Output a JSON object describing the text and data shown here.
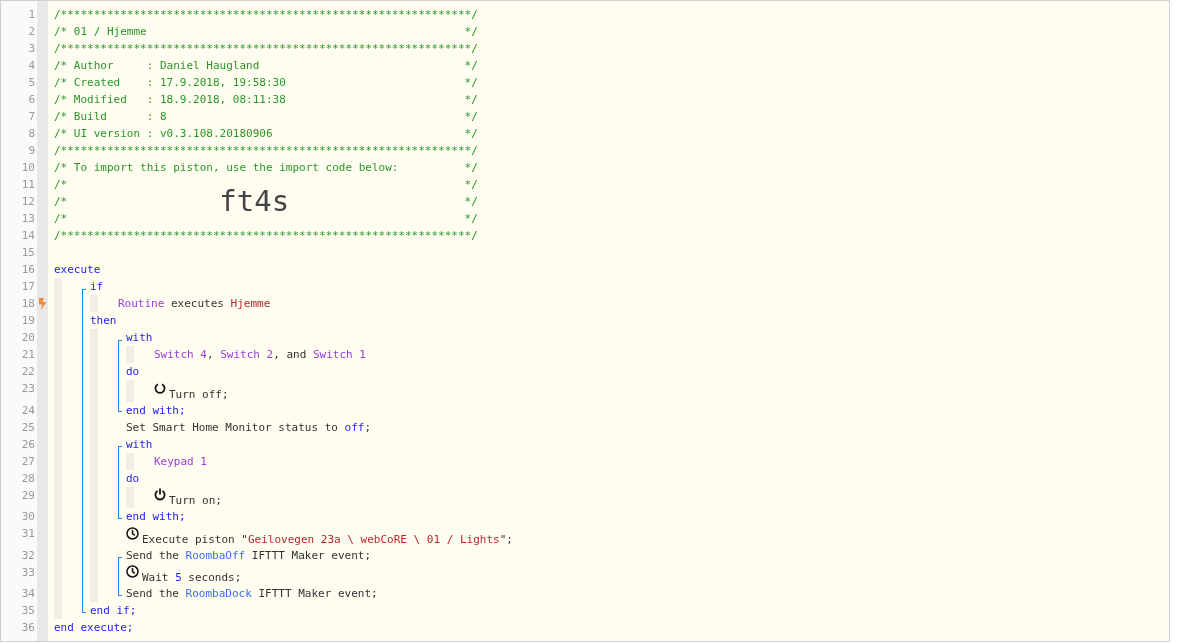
{
  "lines": [
    {
      "line": "1",
      "kind": "comment",
      "trigger": false,
      "tokens": [
        {
          "kind": "comment",
          "text": "/**************************************************************/"
        }
      ]
    },
    {
      "line": "2",
      "kind": "comment",
      "trigger": false,
      "tokens": [
        {
          "kind": "comment",
          "text": "/* 01 / Hjemme"
        },
        {
          "kind": "comment",
          "text": "*/"
        }
      ]
    },
    {
      "line": "3",
      "kind": "comment",
      "trigger": false,
      "tokens": [
        {
          "kind": "comment",
          "text": "/**************************************************************/"
        }
      ]
    },
    {
      "line": "4",
      "kind": "comment",
      "trigger": false,
      "tokens": [
        {
          "kind": "comment",
          "text": "/* Author     : Daniel Haugland"
        },
        {
          "kind": "comment",
          "text": "*/"
        }
      ]
    },
    {
      "line": "5",
      "kind": "comment",
      "trigger": false,
      "tokens": [
        {
          "kind": "comment",
          "text": "/* Created    : 17.9.2018, 19:58:30"
        },
        {
          "kind": "comment",
          "text": "*/"
        }
      ]
    },
    {
      "line": "6",
      "kind": "comment",
      "trigger": false,
      "tokens": [
        {
          "kind": "comment",
          "text": "/* Modified   : 18.9.2018, 08:11:38"
        },
        {
          "kind": "comment",
          "text": "*/"
        }
      ]
    },
    {
      "line": "7",
      "kind": "comment",
      "trigger": false,
      "tokens": [
        {
          "kind": "comment",
          "text": "/* Build      : 8"
        },
        {
          "kind": "comment",
          "text": "*/"
        }
      ]
    },
    {
      "line": "8",
      "kind": "comment",
      "trigger": false,
      "tokens": [
        {
          "kind": "comment",
          "text": "/* UI version : v0.3.108.20180906"
        },
        {
          "kind": "comment",
          "text": "*/"
        }
      ]
    },
    {
      "line": "9",
      "kind": "comment",
      "trigger": false,
      "tokens": [
        {
          "kind": "comment",
          "text": "/**************************************************************/"
        }
      ]
    },
    {
      "line": "10",
      "kind": "comment",
      "trigger": false,
      "tokens": [
        {
          "kind": "comment",
          "text": "/* To import this piston, use the import code below:"
        },
        {
          "kind": "comment",
          "text": "*/"
        }
      ]
    },
    {
      "line": "11",
      "kind": "comment",
      "trigger": false,
      "tokens": [
        {
          "kind": "comment",
          "text": "/*"
        },
        {
          "kind": "comment",
          "text": "*/"
        }
      ]
    },
    {
      "line": "12",
      "kind": "import",
      "trigger": false,
      "tokens": [
        {
          "kind": "comment",
          "text": "/*"
        },
        {
          "kind": "code",
          "text": "ft4s"
        },
        {
          "kind": "comment",
          "text": "*/"
        }
      ]
    },
    {
      "line": "13",
      "kind": "comment",
      "trigger": false,
      "tokens": [
        {
          "kind": "comment",
          "text": "/*"
        },
        {
          "kind": "comment",
          "text": "*/"
        }
      ]
    },
    {
      "line": "14",
      "kind": "comment",
      "trigger": false,
      "tokens": [
        {
          "kind": "comment",
          "text": "/**************************************************************/"
        }
      ]
    },
    {
      "line": "15",
      "kind": "blank",
      "trigger": false
    },
    {
      "line": "16",
      "kind": "statement",
      "trigger": false,
      "tokens": [
        {
          "kind": "keyword",
          "text": "execute"
        }
      ],
      "children": [
        {
          "kind": "group",
          "children": [
            {
              "line": "17",
              "kind": "statement",
              "trigger": false,
              "tokens": [
                {
                  "kind": "keyword",
                  "text": "if"
                }
              ],
              "children": [
                {
                  "line": "18",
                  "kind": "statement",
                  "trigger": true,
                  "tokens": [
                    {
                      "kind": "device",
                      "text": "Routine"
                    },
                    {
                      "kind": "text",
                      "text": " executes "
                    },
                    {
                      "kind": "value",
                      "text": "Hjemme"
                    }
                  ]
                }
              ]
            },
            {
              "line": "19",
              "kind": "statement",
              "trigger": false,
              "tokens": [
                {
                  "kind": "keyword",
                  "text": "then"
                }
              ],
              "children": [
                {
                  "kind": "group",
                  "children": [
                    {
                      "line": "20",
                      "kind": "statement",
                      "trigger": false,
                      "tokens": [
                        {
                          "kind": "keyword",
                          "text": "with"
                        }
                      ],
                      "children": [
                        {
                          "line": "21",
                          "kind": "statement",
                          "trigger": false,
                          "tokens": [
                            {
                              "kind": "device",
                              "text": "Switch 4"
                            },
                            {
                              "kind": "text",
                              "text": ", "
                            },
                            {
                              "kind": "device",
                              "text": "Switch 2"
                            },
                            {
                              "kind": "text",
                              "text": ", and "
                            },
                            {
                              "kind": "device",
                              "text": "Switch 1"
                            }
                          ]
                        }
                      ]
                    },
                    {
                      "line": "22",
                      "kind": "statement",
                      "trigger": false,
                      "tokens": [
                        {
                          "kind": "keyword",
                          "text": "do"
                        }
                      ],
                      "children": [
                        {
                          "line": "23",
                          "kind": "task-off",
                          "trigger": false,
                          "tokens": [
                            {
                              "kind": "text",
                              "text": "Turn off;"
                            }
                          ]
                        }
                      ]
                    },
                    {
                      "line": "24",
                      "kind": "statement",
                      "trigger": false,
                      "tokens": [
                        {
                          "kind": "keyword",
                          "text": "end with;"
                        }
                      ]
                    }
                  ]
                },
                {
                  "line": "25",
                  "kind": "statement",
                  "trigger": false,
                  "tokens": [
                    {
                      "kind": "text",
                      "text": "Set Smart Home Monitor status to "
                    },
                    {
                      "kind": "keyword",
                      "text": "off"
                    },
                    {
                      "kind": "text",
                      "text": ";"
                    }
                  ]
                },
                {
                  "kind": "group",
                  "children": [
                    {
                      "line": "26",
                      "kind": "statement",
                      "trigger": false,
                      "tokens": [
                        {
                          "kind": "keyword",
                          "text": "with"
                        }
                      ],
                      "children": [
                        {
                          "line": "27",
                          "kind": "statement",
                          "trigger": false,
                          "tokens": [
                            {
                              "kind": "device",
                              "text": "Keypad 1"
                            }
                          ]
                        }
                      ]
                    },
                    {
                      "line": "28",
                      "kind": "statement",
                      "trigger": false,
                      "tokens": [
                        {
                          "kind": "keyword",
                          "text": "do"
                        }
                      ],
                      "children": [
                        {
                          "line": "29",
                          "kind": "task-on",
                          "trigger": false,
                          "tokens": [
                            {
                              "kind": "text",
                              "text": "Turn on;"
                            }
                          ]
                        }
                      ]
                    },
                    {
                      "line": "30",
                      "kind": "statement",
                      "trigger": false,
                      "tokens": [
                        {
                          "kind": "keyword",
                          "text": "end with;"
                        }
                      ]
                    }
                  ]
                },
                {
                  "line": "31",
                  "kind": "task-timed",
                  "trigger": false,
                  "tokens": [
                    {
                      "kind": "text",
                      "text": "Execute piston \""
                    },
                    {
                      "kind": "value",
                      "text": "Geilovegen 23a \\ webCoRE \\ 01 / Lights"
                    },
                    {
                      "kind": "text",
                      "text": "\";"
                    }
                  ]
                },
                {
                  "kind": "group",
                  "children": [
                    {
                      "line": "32",
                      "kind": "statement",
                      "trigger": false,
                      "tokens": [
                        {
                          "kind": "text",
                          "text": "Send the "
                        },
                        {
                          "kind": "event",
                          "text": "RoombaOff"
                        },
                        {
                          "kind": "text",
                          "text": " IFTTT Maker event;"
                        }
                      ]
                    },
                    {
                      "line": "33",
                      "kind": "task-timed",
                      "trigger": false,
                      "tokens": [
                        {
                          "kind": "text",
                          "text": "Wait "
                        },
                        {
                          "kind": "number",
                          "text": "5"
                        },
                        {
                          "kind": "text",
                          "text": " seconds;"
                        }
                      ]
                    },
                    {
                      "line": "34",
                      "kind": "statement",
                      "trigger": false,
                      "tokens": [
                        {
                          "kind": "text",
                          "text": "Send the "
                        },
                        {
                          "kind": "event",
                          "text": "RoombaDock"
                        },
                        {
                          "kind": "text",
                          "text": " IFTTT Maker event;"
                        }
                      ]
                    }
                  ]
                }
              ]
            },
            {
              "line": "35",
              "kind": "statement",
              "trigger": false,
              "tokens": [
                {
                  "kind": "keyword",
                  "text": "end if;"
                }
              ]
            }
          ]
        }
      ]
    },
    {
      "line": "36",
      "kind": "statement",
      "trigger": false,
      "tokens": [
        {
          "kind": "keyword",
          "text": "end execute;"
        }
      ]
    }
  ]
}
